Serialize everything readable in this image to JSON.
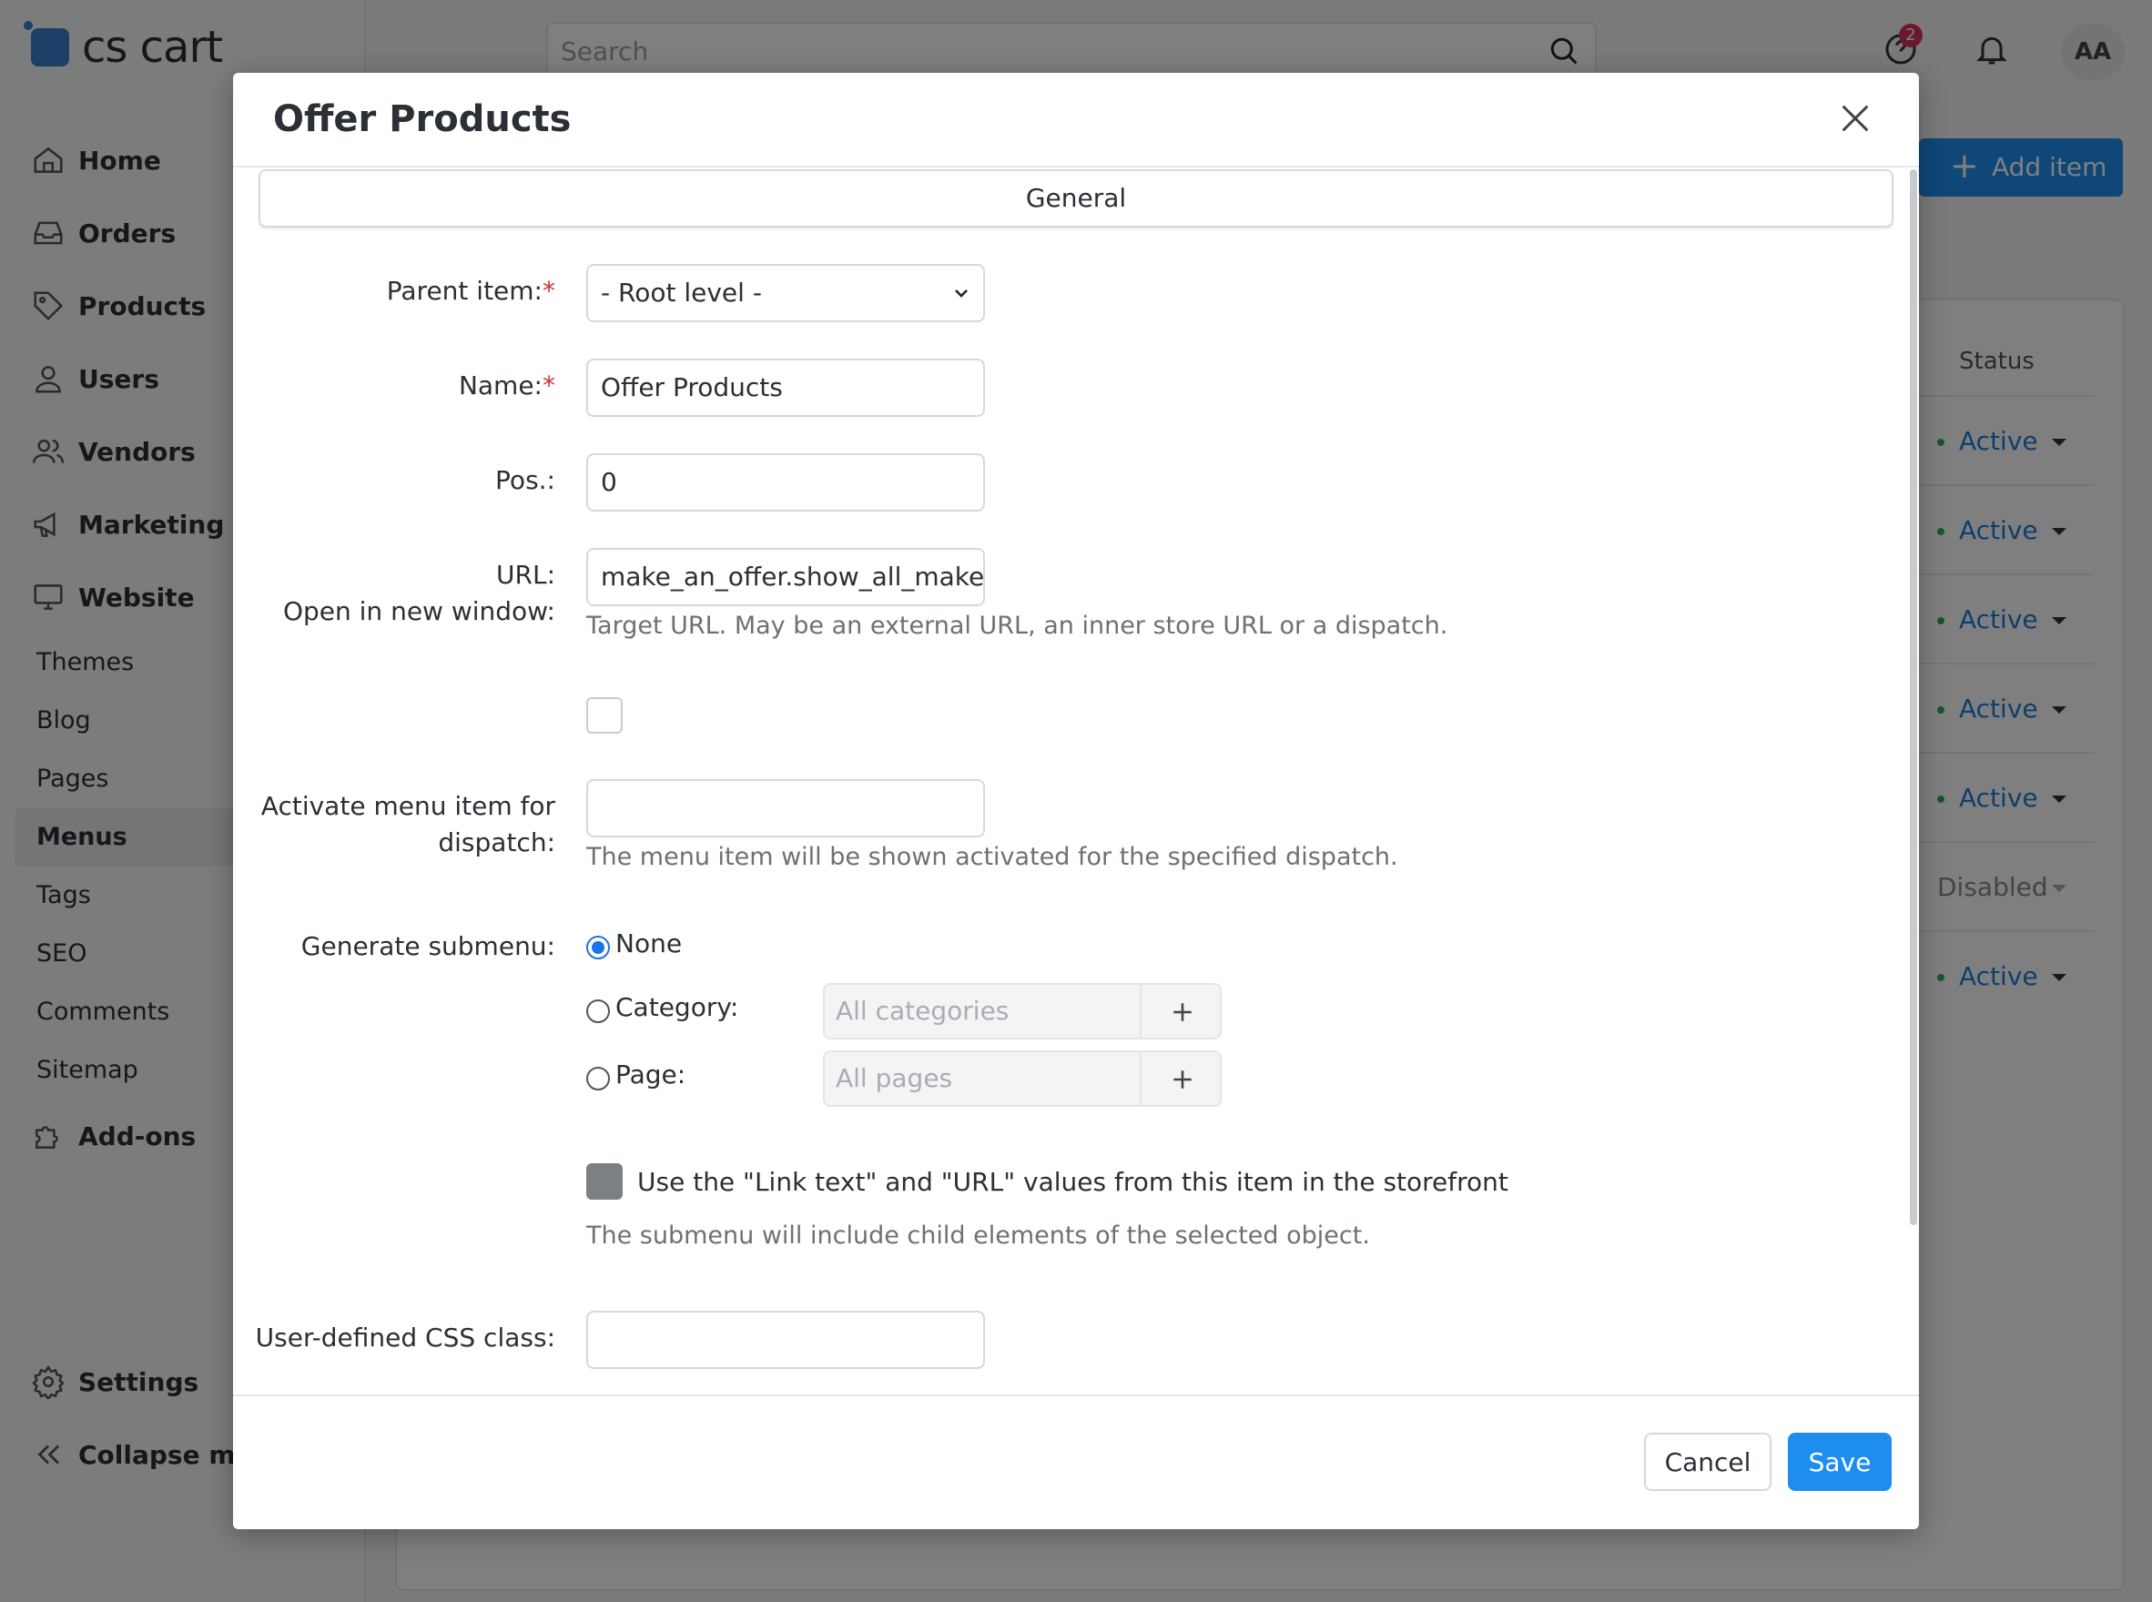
{
  "app": {
    "logo_text": "cs cart",
    "search_placeholder": "Search",
    "notification_badge": "2",
    "avatar_initials": "AA",
    "add_item_label": "Add item"
  },
  "sidebar": {
    "main_items": [
      {
        "label": "Home",
        "icon": "home-icon"
      },
      {
        "label": "Orders",
        "icon": "inbox-icon"
      },
      {
        "label": "Products",
        "icon": "tag-icon"
      },
      {
        "label": "Users",
        "icon": "user-icon"
      },
      {
        "label": "Vendors",
        "icon": "users-icon"
      },
      {
        "label": "Marketing",
        "icon": "megaphone-icon"
      },
      {
        "label": "Website",
        "icon": "monitor-icon"
      }
    ],
    "website_sub_items": [
      "Themes",
      "Blog",
      "Pages",
      "Menus",
      "Tags",
      "SEO",
      "Comments",
      "Sitemap"
    ],
    "active_sub_item": "Menus",
    "addons_label": "Add-ons",
    "settings_label": "Settings",
    "collapse_label": "Collapse menu"
  },
  "table": {
    "status_header": "Status",
    "statuses": [
      "Active",
      "Active",
      "Active",
      "Active",
      "Active",
      "Disabled",
      "Active"
    ]
  },
  "modal": {
    "title": "Offer Products",
    "tab_general": "General",
    "parent_item_label": "Parent item:",
    "parent_item_value": "- Root level -",
    "name_label": "Name:",
    "name_value": "Offer Products",
    "pos_label": "Pos.:",
    "pos_value": "0",
    "url_label": "URL:",
    "url_value": "make_an_offer.show_all_make_an_offer",
    "url_help": "Target URL. May be an external URL, an inner store URL or a dispatch.",
    "new_window_label": "Open in new window:",
    "activate_label_1": "Activate menu item for",
    "activate_label_2": "dispatch:",
    "activate_value": "",
    "activate_help": "The menu item will be shown activated for the specified dispatch.",
    "submenu_label": "Generate submenu:",
    "submenu_options": {
      "none": "None",
      "category": "Category:",
      "page": "Page:"
    },
    "category_placeholder": "All categories",
    "page_placeholder": "All pages",
    "use_link_text_label": "Use the \"Link text\" and \"URL\" values from this item in the storefront",
    "submenu_help": "The submenu will include child elements of the selected object.",
    "css_class_label": "User-defined CSS class:",
    "css_class_value": "",
    "cancel_label": "Cancel",
    "save_label": "Save"
  },
  "colors": {
    "accent": "#1d8ef0",
    "status_active": "#1a7fd9",
    "required": "#d32f2f"
  }
}
